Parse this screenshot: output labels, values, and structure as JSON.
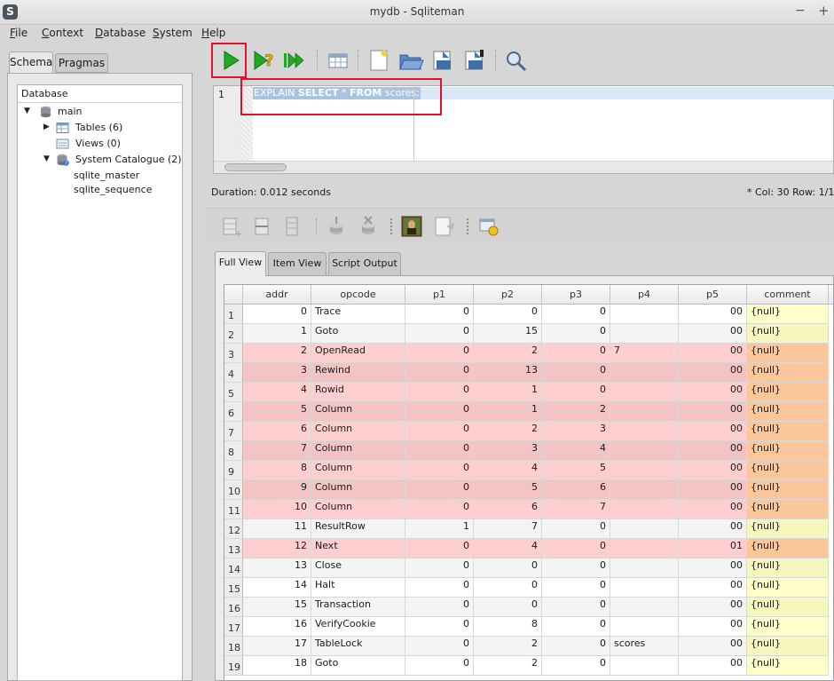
{
  "window": {
    "title": "mydb - Sqliteman",
    "logo": "S",
    "min": "−",
    "max": "+"
  },
  "menu": [
    "File",
    "Context",
    "Database",
    "System",
    "Help"
  ],
  "left_tabs": {
    "schema": "Schema",
    "pragmas": "Pragmas"
  },
  "tree": {
    "header": "Database",
    "items": [
      {
        "label": "main",
        "icon": "database-icon",
        "arrow": "▼"
      },
      {
        "label": "Tables (6)",
        "icon": "table-icon",
        "arrow": "▶"
      },
      {
        "label": "Views (0)",
        "icon": "view-icon",
        "arrow": ""
      },
      {
        "label": "System Catalogue (2)",
        "icon": "system-catalogue-icon",
        "arrow": "▼"
      },
      {
        "label": "sqlite_master",
        "icon": "",
        "arrow": ""
      },
      {
        "label": "sqlite_sequence",
        "icon": "",
        "arrow": ""
      }
    ]
  },
  "toolbar": {
    "icons": [
      "run-icon",
      "explain-icon",
      "run-script-icon",
      "tables-icon",
      "new-file-icon",
      "open-folder-icon",
      "save-file-icon",
      "save-as-icon",
      "search-icon"
    ]
  },
  "editor": {
    "line_number": "1",
    "kw_explain": "EXPLAIN",
    "kw_select": "SELECT",
    "star": "*",
    "kw_from": "FROM",
    "table": "scores;"
  },
  "status": {
    "duration": "Duration: 0.012 seconds",
    "position": "*  Col: 30 Row: 1/1"
  },
  "result_toolbar": {
    "icons": [
      "insert-row-icon",
      "remove-row-icon",
      "duplicate-row-icon",
      "commit-icon",
      "rollback-icon",
      "image-viewer-icon",
      "export-icon",
      "action-icon"
    ]
  },
  "result_tabs": {
    "full": "Full View",
    "item": "Item View",
    "script": "Script Output"
  },
  "grid": {
    "columns": [
      "addr",
      "opcode",
      "p1",
      "p2",
      "p3",
      "p4",
      "p5",
      "comment"
    ],
    "rows": [
      [
        "1",
        "0",
        "Trace",
        "0",
        "0",
        "0",
        "",
        "00",
        "{null}"
      ],
      [
        "2",
        "1",
        "Goto",
        "0",
        "15",
        "0",
        "",
        "00",
        "{null}"
      ],
      [
        "3",
        "2",
        "OpenRead",
        "0",
        "2",
        "0",
        "7",
        "00",
        "{null}"
      ],
      [
        "4",
        "3",
        "Rewind",
        "0",
        "13",
        "0",
        "",
        "00",
        "{null}"
      ],
      [
        "5",
        "4",
        "Rowid",
        "0",
        "1",
        "0",
        "",
        "00",
        "{null}"
      ],
      [
        "6",
        "5",
        "Column",
        "0",
        "1",
        "2",
        "",
        "00",
        "{null}"
      ],
      [
        "7",
        "6",
        "Column",
        "0",
        "2",
        "3",
        "",
        "00",
        "{null}"
      ],
      [
        "8",
        "7",
        "Column",
        "0",
        "3",
        "4",
        "",
        "00",
        "{null}"
      ],
      [
        "9",
        "8",
        "Column",
        "0",
        "4",
        "5",
        "",
        "00",
        "{null}"
      ],
      [
        "10",
        "9",
        "Column",
        "0",
        "5",
        "6",
        "",
        "00",
        "{null}"
      ],
      [
        "11",
        "10",
        "Column",
        "0",
        "6",
        "7",
        "",
        "00",
        "{null}"
      ],
      [
        "12",
        "11",
        "ResultRow",
        "1",
        "7",
        "0",
        "",
        "00",
        "{null}"
      ],
      [
        "13",
        "12",
        "Next",
        "0",
        "4",
        "0",
        "",
        "01",
        "{null}"
      ],
      [
        "14",
        "13",
        "Close",
        "0",
        "0",
        "0",
        "",
        "00",
        "{null}"
      ],
      [
        "15",
        "14",
        "Halt",
        "0",
        "0",
        "0",
        "",
        "00",
        "{null}"
      ],
      [
        "16",
        "15",
        "Transaction",
        "0",
        "0",
        "0",
        "",
        "00",
        "{null}"
      ],
      [
        "17",
        "16",
        "VerifyCookie",
        "0",
        "8",
        "0",
        "",
        "00",
        "{null}"
      ],
      [
        "18",
        "17",
        "TableLock",
        "0",
        "2",
        "0",
        "scores",
        "00",
        "{null}"
      ],
      [
        "19",
        "18",
        "Goto",
        "0",
        "2",
        "0",
        "",
        "00",
        "{null}"
      ]
    ],
    "row_styles": [
      "w",
      "w",
      "p",
      "p2",
      "p",
      "p2",
      "p",
      "p2",
      "p",
      "p2",
      "p",
      "w",
      "p",
      "w",
      "w",
      "w",
      "w",
      "w",
      "w"
    ]
  },
  "colors": {
    "highlight": "#e2102a",
    "run_green": "#22a822",
    "selection": "#a8c4e2",
    "row_pink": "#ffcfcf",
    "comment_yellow": "#fefec8",
    "comment_orange": "#fbc79a"
  }
}
